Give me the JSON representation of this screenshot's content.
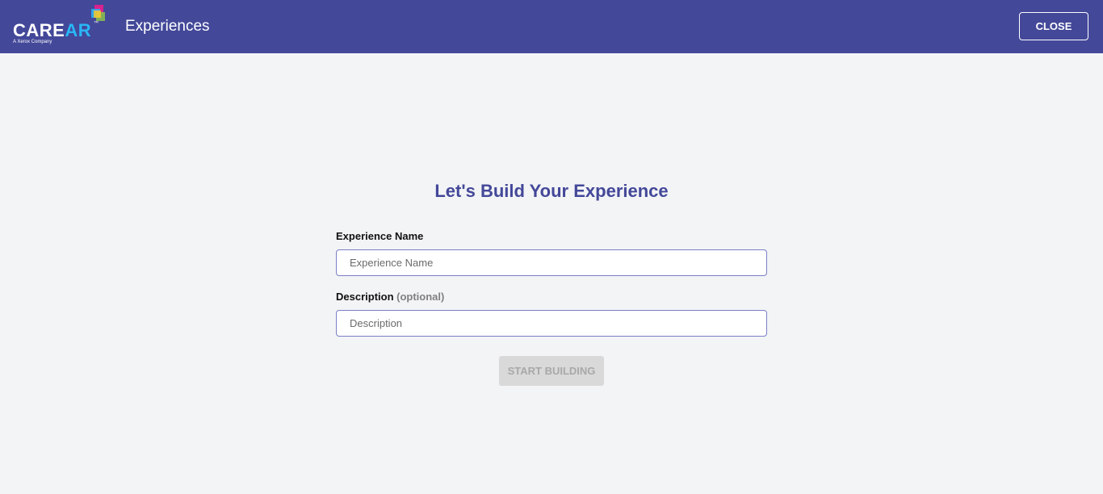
{
  "header": {
    "logo": {
      "brand_part1": "CARE",
      "brand_part2": "AR",
      "trademark": "™",
      "tagline": "A Xerox Company",
      "icon": "stacked-cube-logo-icon"
    },
    "title": "Experiences",
    "close_label": "CLOSE"
  },
  "form": {
    "heading": "Let's Build Your Experience",
    "name_label": "Experience Name",
    "name_placeholder": "Experience Name",
    "name_value": "",
    "description_label": "Description",
    "description_optional": "(optional)",
    "description_placeholder": "Description",
    "description_value": "",
    "submit_label": "START BUILDING",
    "submit_disabled": true
  },
  "colors": {
    "header_bg": "#434899",
    "page_bg": "#f3f4f6",
    "heading": "#434899",
    "input_border": "#7a7fc6",
    "disabled_button_bg": "#d9d9d9",
    "disabled_button_text": "#a8a8a8",
    "logo_accent": "#29b6f6"
  }
}
